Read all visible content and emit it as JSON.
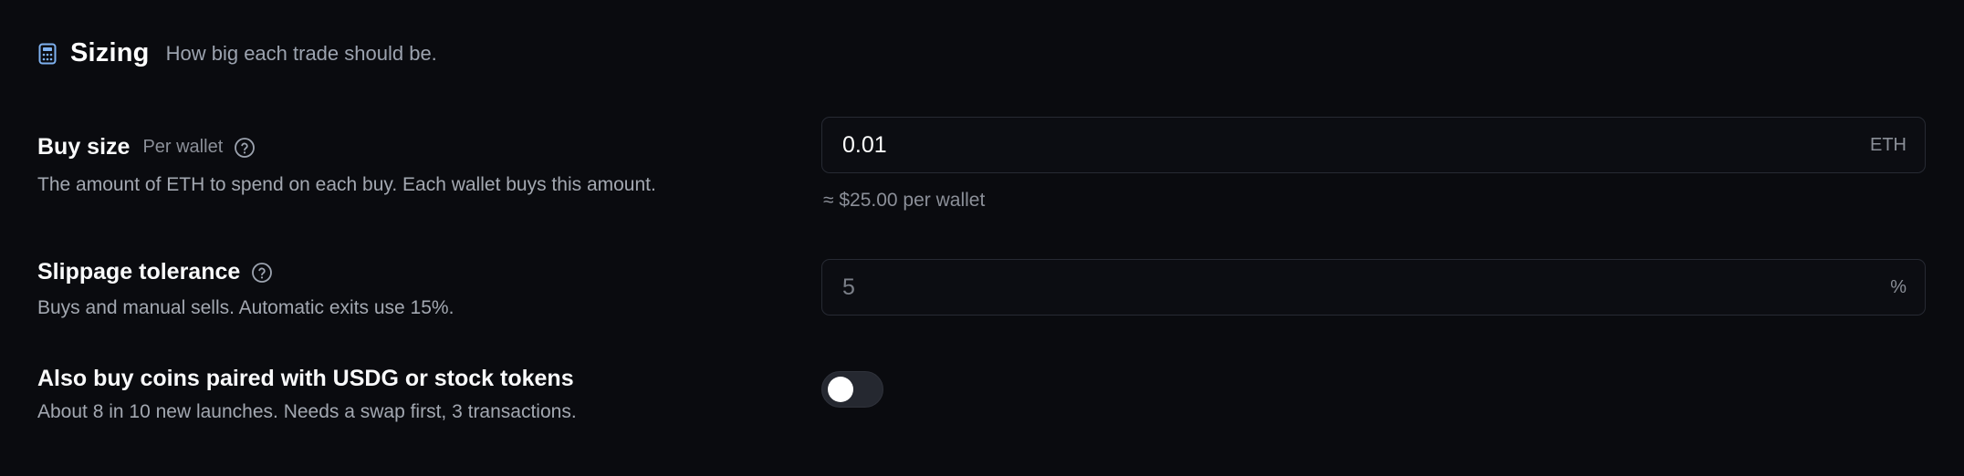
{
  "section": {
    "icon": "calculator-icon",
    "title": "Sizing",
    "subtitle": "How big each trade should be."
  },
  "buy_size": {
    "label": "Buy size",
    "aside": "Per wallet",
    "help_icon": "question-circle-icon",
    "description": "The amount of ETH to spend on each buy. Each wallet buys this amount.",
    "value": "0.01",
    "unit": "ETH",
    "hint": "≈ $25.00 per wallet"
  },
  "slippage": {
    "label": "Slippage tolerance",
    "help_icon": "question-circle-icon",
    "description": "Buys and manual sells. Automatic exits use 15%.",
    "placeholder": "5",
    "unit": "%"
  },
  "paired_coins": {
    "label": "Also buy coins paired with USDG or stock tokens",
    "description": "About 8 in 10 new launches. Needs a swap first, 3 transactions.",
    "enabled": false
  },
  "colors": {
    "background": "#0a0b0f",
    "accent_icon": "#7fb2f0",
    "muted_text": "#8b8f98"
  }
}
